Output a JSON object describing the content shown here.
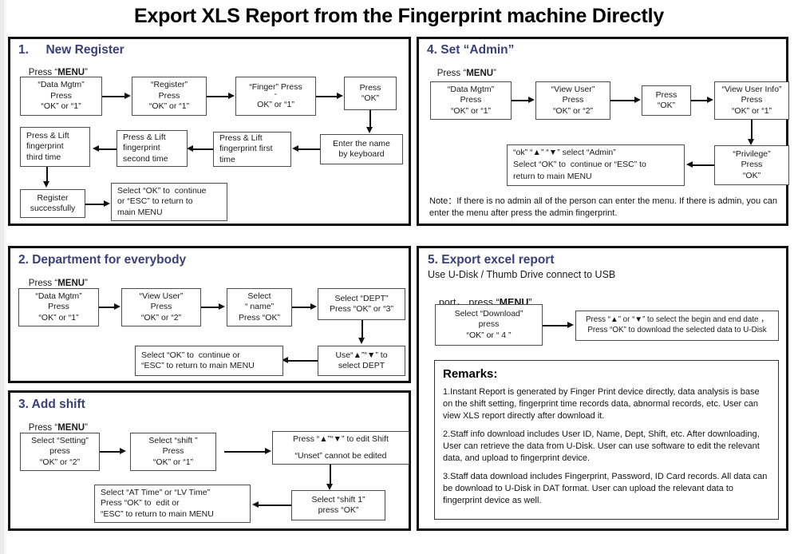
{
  "document": {
    "title": "Export XLS Report from the Fingerprint machine Directly"
  },
  "sections": {
    "new_register": {
      "heading": "1.     New Register",
      "subheading_prefix": "Press “",
      "subheading_key": "MENU",
      "subheading_suffix": "”",
      "boxes": {
        "data_mgtm": [
          "“Data Mgtm”",
          "Press",
          "“OK” or “1”"
        ],
        "register": [
          "“Register”",
          "Press",
          "“OK” or “1”"
        ],
        "finger": [
          "“Finger” Press",
          "“",
          "OK” or “1”"
        ],
        "press_ok": [
          "Press",
          "“OK”"
        ],
        "enter_name": [
          "Enter the name",
          "by keyboard"
        ],
        "fp_first": [
          "Press & Lift",
          "fingerprint first",
          "time"
        ],
        "fp_second": [
          "Press & Lift",
          "fingerprint",
          "second time"
        ],
        "fp_third": [
          "Press & Lift",
          "fingerprint",
          "third time"
        ],
        "register_ok": [
          "Register",
          "successfully"
        ],
        "continue": [
          "Select “OK” to  continue",
          "or “ESC” to return to",
          "main MENU"
        ]
      }
    },
    "department": {
      "heading": "2. Department for everybody",
      "subheading_prefix": "Press “",
      "subheading_key": "MENU",
      "subheading_suffix": "”",
      "boxes": {
        "data_mgtm": [
          "“Data Mgtm”",
          "Press",
          "“OK” or “1”"
        ],
        "view_user": [
          "“View User”",
          "Press",
          "“OK” or “2”"
        ],
        "select_name": [
          "Select",
          "“ name”",
          "Press “OK”"
        ],
        "select_dept": [
          "Select “DEPT”",
          "Press “OK” or “3”"
        ],
        "use_arrows": [
          "Use“▲”“▼” to",
          "select DEPT"
        ],
        "continue": [
          "Select “OK” to  continue or",
          "“ESC” to return to main MENU"
        ]
      }
    },
    "add_shift": {
      "heading": "3. Add shift",
      "subheading_prefix": "Press “",
      "subheading_key": "MENU",
      "subheading_suffix": "”",
      "boxes": {
        "select_setting": [
          "Select “Setting”",
          "press",
          "“OK” or “2”"
        ],
        "select_shift": [
          "Select “shift ”",
          "Press",
          "“OK” or “1”"
        ],
        "edit_shift": [
          "Press “▲”“▼” to edit Shift",
          "“Unset” cannot be edited"
        ],
        "select_shift1": [
          "Select “shift 1”",
          "press “OK”"
        ],
        "at_lv_time": [
          "Select “AT Time” or “LV Time”",
          "Press “OK” to  edit or",
          "“ESC” to return to main MENU"
        ]
      }
    },
    "set_admin": {
      "heading": "4. Set “Admin”",
      "subheading_prefix": "Press “",
      "subheading_key": "MENU",
      "subheading_suffix": "”",
      "boxes": {
        "data_mgtm": [
          "“Data Mgtm”",
          "Press",
          "“OK” or “1”"
        ],
        "view_user": [
          "“View User”",
          "Press",
          "“OK” or “2”"
        ],
        "press_ok": [
          "Press",
          "“OK”"
        ],
        "view_user_info": [
          "“View User Info”",
          "Press",
          "“OK” or “1”"
        ],
        "privilege": [
          "“Privilege”",
          "Press",
          "“OK”"
        ],
        "select_admin": [
          "“ok” “▲” “▼” select “Admin”",
          "Select “OK” to  continue or “ESC” to",
          "return to main MENU"
        ]
      },
      "note": "Note：If there is no admin all of the person can enter the menu. If there is admin, you can enter the menu after press the admin fingerprint."
    },
    "export_excel": {
      "heading": "5. Export excel report",
      "subheading_line1": "Use U-Disk / Thumb Drive connect to USB",
      "subheading_line2_prefix": "port， press “",
      "subheading_key": "MENU",
      "subheading_line2_suffix": "”",
      "boxes": {
        "select_download": [
          "Select “Download”",
          "press",
          "“OK” or “ 4 ”"
        ],
        "select_dates": [
          "Press “▲” or “▼” to select the begin and end date ，",
          "Press “OK” to download the selected data to U-Disk"
        ]
      }
    },
    "remarks": {
      "heading": "Remarks:",
      "items": [
        "1.Instant Report is generated by Finger Print device directly, data analysis is base on the shift setting, fingerprint time records data, abnormal records, etc. User can view XLS report directly after download it.",
        "2.Staff info download includes User ID, Name, Dept, Shift, etc. After downloading, User can retrieve the data from U-Disk. User can use software to edit the relevant data, and upload to fingerprint device.",
        "3.Staff data download includes Fingerprint, Password, ID Card records. All data can be download to U-Disk in DAT format. User can upload the relevant data to fingerprint device as well."
      ]
    }
  },
  "colors": {
    "heading": "#3b3f77",
    "border": "#111111",
    "box_border": "#4d4d4d",
    "text": "#1a1a1a"
  }
}
